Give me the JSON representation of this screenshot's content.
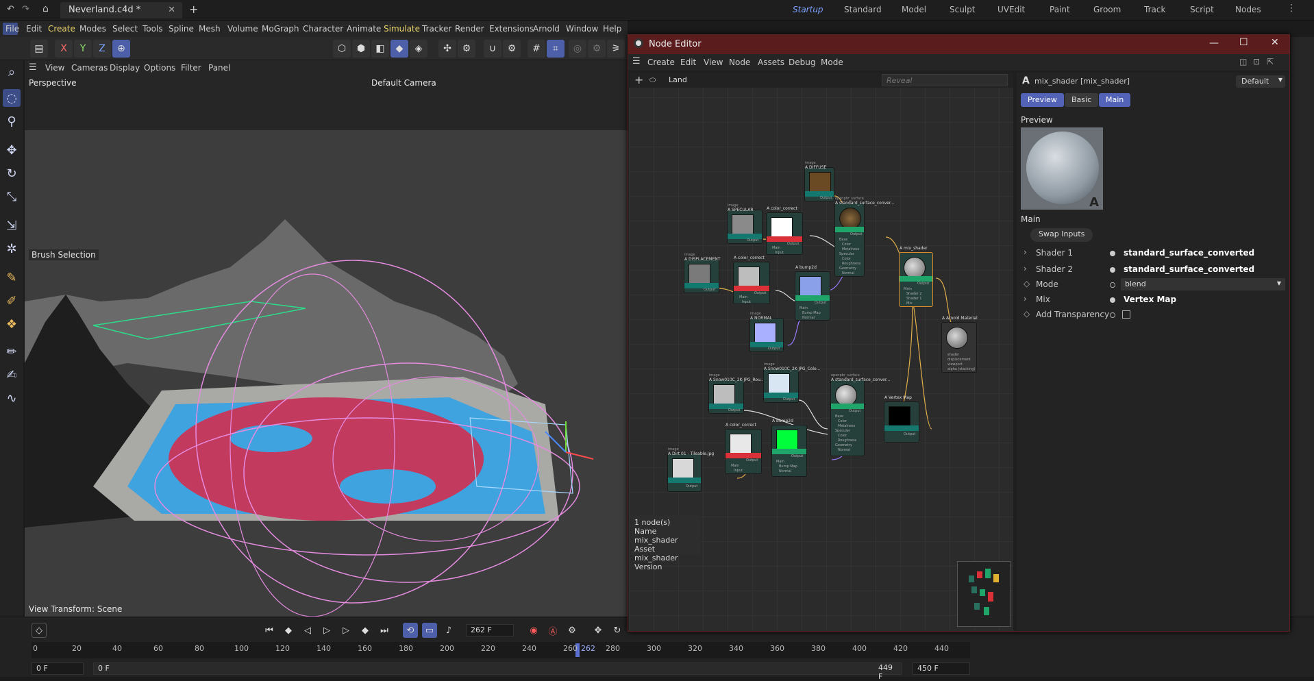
{
  "titlebar": {
    "doc_tab": "Neverland.c4d *",
    "layouts": [
      "Startup",
      "Standard",
      "Model",
      "Sculpt",
      "UVEdit",
      "Paint",
      "Groom",
      "Track",
      "Script",
      "Nodes"
    ],
    "active_layout": "Startup"
  },
  "menubar": {
    "items": [
      "File",
      "Edit",
      "Create",
      "Modes",
      "Select",
      "Tools",
      "Spline",
      "Mesh",
      "Volume",
      "MoGraph",
      "Character",
      "Animate",
      "Simulate",
      "Tracker",
      "Render",
      "Extensions",
      "Arnold",
      "Window",
      "Help"
    ]
  },
  "toolbar": {
    "axes": [
      "X",
      "Y",
      "Z"
    ]
  },
  "viewport": {
    "menu": [
      "View",
      "Cameras",
      "Display",
      "Options",
      "Filter",
      "Panel"
    ],
    "name": "Perspective",
    "camera": "Default Camera",
    "brush_label": "Brush Selection",
    "transform_label": "View Transform: Scene"
  },
  "timeline": {
    "current_frame": "262 F",
    "ruler": [
      "0",
      "20",
      "40",
      "60",
      "80",
      "100",
      "120",
      "140",
      "160",
      "180",
      "200",
      "220",
      "240",
      "260",
      "262",
      "280",
      "300",
      "320",
      "340",
      "360",
      "380",
      "400",
      "420",
      "440"
    ],
    "start_frame": "0 F",
    "min_frame": "0 F",
    "end_frame": "449 F",
    "max_frame": "450 F"
  },
  "node_editor": {
    "title": "Node Editor",
    "menu": [
      "Create",
      "Edit",
      "View",
      "Node",
      "Assets",
      "Debug",
      "Mode"
    ],
    "breadcrumb": "Land",
    "search_placeholder": "Reveal",
    "nodes": {
      "diffuse_type": "image",
      "diffuse": "DIFFUSE",
      "specular_type": "image",
      "specular": "SPECULAR",
      "cc1": "color_correct",
      "disp_type": "image",
      "displacement": "DISPLACEMENT",
      "cc2": "color_correct",
      "bump1": "bump2d",
      "normal_type": "image",
      "normal": "NORMAL",
      "ss1_type": "openpbr_surface",
      "ss1": "standard_surface_conver...",
      "mix": "mix_shader",
      "arnold": "Arnold Material",
      "snow1_type": "image",
      "snow1": "Snow010C_2K-JPG_Rou...",
      "snow2_type": "image",
      "snow2": "Snow010C_2K-JPG_Colo...",
      "ss2_type": "openpbr_surface",
      "ss2": "standard_surface_conver...",
      "vmap": "Vertex Map",
      "cc3": "color_correct",
      "bump2": "bump2d",
      "dirt_type": "image",
      "dirt": "Dirt 01 - Tileable.jpg",
      "output": "Output",
      "input": "Input",
      "main": "Main",
      "base": "Base",
      "color": "Color",
      "metalness": "Metalness",
      "specular_port": "Specular",
      "roughness": "Roughness",
      "geometry": "Geometry",
      "normal_port": "Normal",
      "bump_map": "Bump Map",
      "shader1": "Shader 1",
      "shader2": "Shader 2",
      "mix_port": "Mix",
      "surface": "shader",
      "displacement_port": "displacement",
      "viewport": "viewport",
      "alpha": "alpha (stacking)"
    },
    "info": {
      "count": "1 node(s)",
      "name_label": "Name",
      "name_value": "mix_shader",
      "asset_label": "Asset",
      "asset_value": "mix_shader",
      "version_label": "Version"
    },
    "props": {
      "header": "mix_shader [mix_shader]",
      "preset": "Default",
      "tabs": [
        "Preview",
        "Basic",
        "Main"
      ],
      "preview_heading": "Preview",
      "main_heading": "Main",
      "swap_button": "Swap Inputs",
      "shader1_label": "Shader 1",
      "shader1_value": "standard_surface_converted",
      "shader2_label": "Shader 2",
      "shader2_value": "standard_surface_converted",
      "mode_label": "Mode",
      "mode_value": "blend",
      "mix_label": "Mix",
      "mix_value": "Vertex Map",
      "transparency_label": "Add Transparency"
    }
  }
}
